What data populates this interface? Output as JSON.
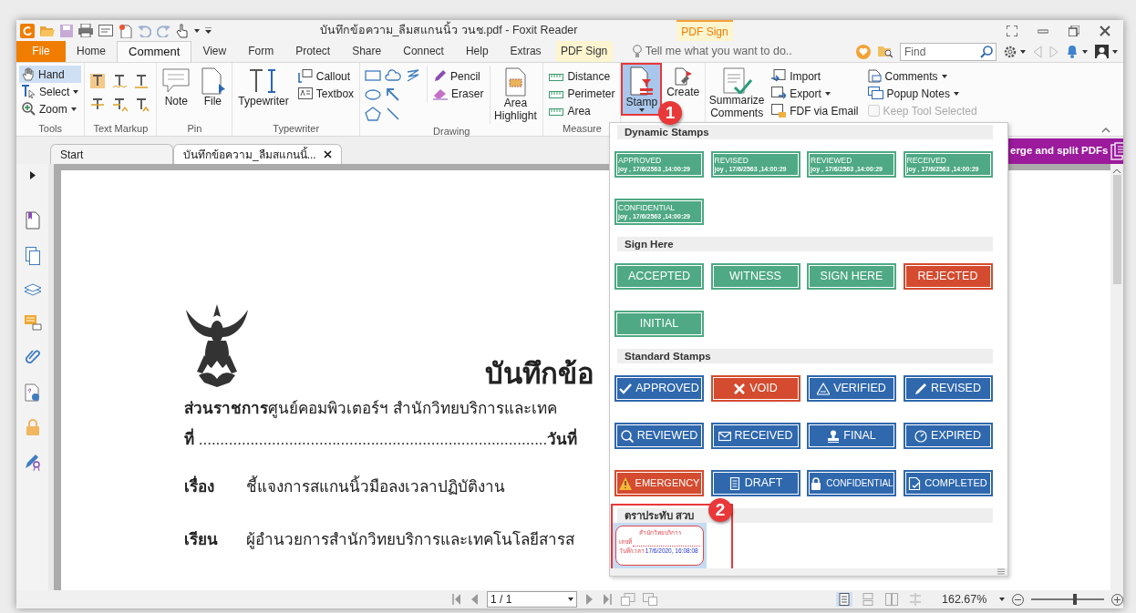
{
  "window": {
    "title": "บันทึกข้อความ_ลืมสแกนนิ้ว วนช.pdf - Foxit Reader",
    "context_group": "PDF Sign"
  },
  "ribbon_tabs": [
    {
      "label": "File",
      "kind": "file",
      "selected": false
    },
    {
      "label": "Home",
      "kind": "tab",
      "selected": false
    },
    {
      "label": "Comment",
      "kind": "tab",
      "selected": true
    },
    {
      "label": "View",
      "kind": "tab",
      "selected": false
    },
    {
      "label": "Form",
      "kind": "tab",
      "selected": false
    },
    {
      "label": "Protect",
      "kind": "tab",
      "selected": false
    },
    {
      "label": "Share",
      "kind": "tab",
      "selected": false
    },
    {
      "label": "Connect",
      "kind": "tab",
      "selected": false
    },
    {
      "label": "Help",
      "kind": "tab",
      "selected": false
    },
    {
      "label": "Extras",
      "kind": "tab",
      "selected": false
    },
    {
      "label": "PDF Sign",
      "kind": "context",
      "selected": false
    }
  ],
  "tell_me": {
    "placeholder": "Tell me what you want to do.."
  },
  "find": {
    "placeholder": "Find"
  },
  "ribbon": {
    "tools": {
      "label": "Tools",
      "items": [
        {
          "label": "Hand",
          "dropdown": false,
          "selected": true
        },
        {
          "label": "Select",
          "dropdown": true,
          "selected": false
        },
        {
          "label": "Zoom",
          "dropdown": true,
          "selected": false
        }
      ]
    },
    "text_markup": {
      "label": "Text Markup"
    },
    "pin": {
      "label": "Pin",
      "items": [
        "Note",
        "File"
      ]
    },
    "typewriter": {
      "label": "Typewriter",
      "items": [
        "Typewriter",
        "Callout",
        "Textbox"
      ]
    },
    "drawing": {
      "label": "Drawing",
      "items": [
        "Pencil",
        "Eraser",
        "Area Highlight"
      ]
    },
    "measure": {
      "label": "Measure",
      "items": [
        "Distance",
        "Perimeter",
        "Area"
      ]
    },
    "stamp": {
      "label": "Stamp",
      "selected": true
    },
    "create": {
      "label": "Create"
    },
    "summarize": {
      "label": "Summarize Comments"
    },
    "manage": [
      {
        "label": "Import",
        "dropdown": false
      },
      {
        "label": "Export",
        "dropdown": true
      },
      {
        "label": "FDF via Email",
        "dropdown": false
      }
    ],
    "view": [
      {
        "label": "Comments",
        "dropdown": true
      },
      {
        "label": "Popup Notes",
        "dropdown": true
      }
    ],
    "keep_tool_selected": {
      "label": "Keep Tool Selected",
      "checked": false,
      "disabled": true
    }
  },
  "doc_tabs": [
    {
      "label": "Start",
      "selected": false,
      "closable": false
    },
    {
      "label": "บันทึกข้อความ_ลืมสแกนนิ้...",
      "selected": true,
      "closable": true
    }
  ],
  "banner": {
    "text": "erge and split PDFs"
  },
  "document": {
    "title": "บันทึกข้อ",
    "header_lines": [
      "**ส่วนราชการ**ศูนย์คอมพิวเตอร์ฯ สำนักวิทยบริการและเทค",
      "**ที่** .................................................................................**วันที่**"
    ],
    "fields": [
      {
        "label": "เรื่อง",
        "value": "ชี้แจงการสแกนนิ้วมือลงเวลาปฏิบัติงาน"
      },
      {
        "label": "เรียน",
        "value": "ผู้อำนวยการสำนักวิทยบริการและเทคโนโลยีสารส"
      }
    ]
  },
  "stamp_menu": {
    "sections": [
      {
        "title": "Dynamic Stamps",
        "stamps": [
          {
            "kind": "dynamic",
            "label": "APPROVED",
            "detail": "joy , 17/6/2563 ,14:00:29",
            "color": "#4ea984",
            "selected": false
          },
          {
            "kind": "dynamic",
            "label": "REVISED",
            "detail": "joy , 17/6/2563 ,14:00:29",
            "color": "#4ea984",
            "selected": false
          },
          {
            "kind": "dynamic",
            "label": "REVIEWED",
            "detail": "joy , 17/6/2563 ,14:00:29",
            "color": "#4ea984",
            "selected": false
          },
          {
            "kind": "dynamic",
            "label": "RECEIVED",
            "detail": "joy , 17/6/2563 ,14:00:29",
            "color": "#4ea984",
            "selected": false
          },
          {
            "kind": "dynamic",
            "label": "CONFIDENTIAL",
            "detail": "joy , 17/6/2563 ,14:00:29",
            "color": "#4ea984",
            "selected": false
          }
        ]
      },
      {
        "title": "Sign Here",
        "stamps": [
          {
            "kind": "sign",
            "label": "ACCEPTED",
            "color": "#4ea984",
            "selected": false
          },
          {
            "kind": "sign",
            "label": "WITNESS",
            "color": "#4ea984",
            "selected": false
          },
          {
            "kind": "sign",
            "label": "SIGN HERE",
            "color": "#4ea984",
            "selected": false
          },
          {
            "kind": "sign",
            "label": "REJECTED",
            "color": "#d44b2f",
            "selected": false
          },
          {
            "kind": "sign",
            "label": "INITIAL",
            "color": "#4ea984",
            "selected": false
          }
        ]
      },
      {
        "title": "Standard Stamps",
        "stamps": [
          {
            "kind": "standard",
            "label": "APPROVED",
            "color": "#2f68ad",
            "selected": false
          },
          {
            "kind": "standard",
            "label": "VOID",
            "color": "#d44b2f",
            "selected": false
          },
          {
            "kind": "standard",
            "label": "VERIFIED",
            "color": "#2f68ad",
            "selected": false
          },
          {
            "kind": "standard",
            "label": "REVISED",
            "color": "#2f68ad",
            "selected": false
          },
          {
            "kind": "standard",
            "label": "REVIEWED",
            "color": "#2f68ad",
            "selected": false
          },
          {
            "kind": "standard",
            "label": "RECEIVED",
            "color": "#2f68ad",
            "selected": false
          },
          {
            "kind": "standard",
            "label": "FINAL",
            "color": "#2f68ad",
            "selected": false
          },
          {
            "kind": "standard",
            "label": "EXPIRED",
            "color": "#2f68ad",
            "selected": false
          },
          {
            "kind": "standard",
            "label": "EMERGENCY",
            "color": "#d44b2f",
            "selected": false
          },
          {
            "kind": "standard",
            "label": "DRAFT",
            "color": "#2f68ad",
            "selected": false
          },
          {
            "kind": "standard",
            "label": "CONFIDENTIAL",
            "color": "#2f68ad",
            "selected": false
          },
          {
            "kind": "standard",
            "label": "COMPLETED",
            "color": "#2f68ad",
            "selected": false
          }
        ]
      },
      {
        "title": "ตราประทับ สวบ",
        "stamps": [
          {
            "kind": "custom",
            "label": "สำนักวิทยบริการ",
            "number_label": "เลขที่",
            "date_label": "วันที่/เวลา",
            "date": "17/6/2020, 16:08:08",
            "color": "#e0484f",
            "selected": true
          }
        ]
      }
    ]
  },
  "callouts": [
    "1",
    "2"
  ],
  "status_bar": {
    "page": "1 / 1",
    "zoom": "162.67%",
    "zoom_slider": {
      "level": 0.6
    },
    "view_modes": [
      {
        "selected": true
      },
      {
        "selected": false
      },
      {
        "selected": false
      },
      {
        "selected": false
      }
    ]
  }
}
